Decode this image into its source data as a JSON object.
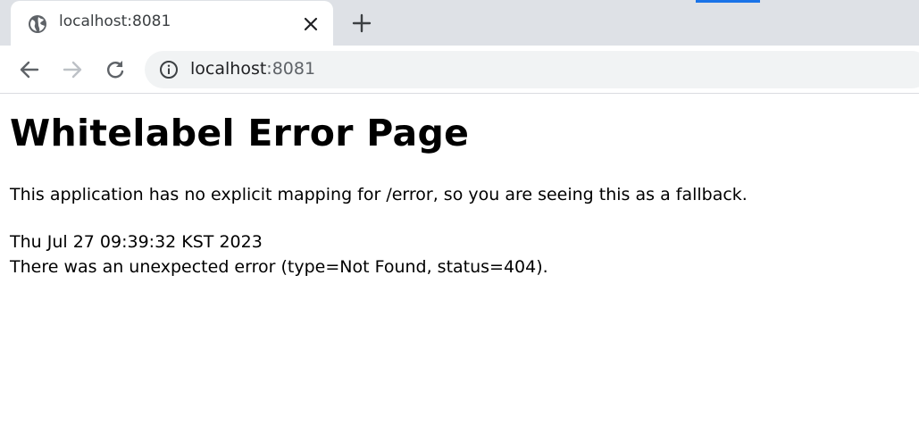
{
  "browser": {
    "tab": {
      "title": "localhost:8081"
    },
    "address_bar": {
      "host": "localhost",
      "port": ":8081"
    },
    "icons": {
      "tab_favicon": "globe-icon",
      "tab_close": "close-icon",
      "new_tab": "plus-icon",
      "back": "back-arrow-icon",
      "forward": "forward-arrow-icon",
      "reload": "reload-icon",
      "site_info": "info-icon"
    }
  },
  "page": {
    "heading": "Whitelabel Error Page",
    "message": "This application has no explicit mapping for /error, so you are seeing this as a fallback.",
    "timestamp": "Thu Jul 27 09:39:32 KST 2023",
    "error": "There was an unexpected error (type=Not Found, status=404)."
  },
  "colors": {
    "tabstrip": "#dee1e6",
    "omnibox": "#f1f3f4",
    "accent": "#1a73e8"
  }
}
